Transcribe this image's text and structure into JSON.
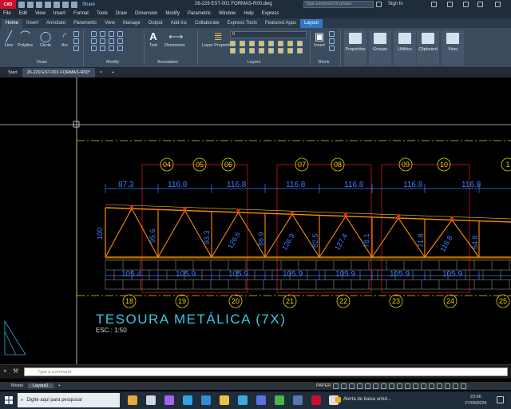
{
  "window": {
    "app_badge": "CAD",
    "share_label": "Share",
    "title": "26-229 EST-001 FORMAS-R00.dwg",
    "search_placeholder": "Type a keyword or phrase",
    "sign_in": "Sign In"
  },
  "menu": [
    "File",
    "Edit",
    "View",
    "Insert",
    "Format",
    "Tools",
    "Draw",
    "Dimension",
    "Modify",
    "Parametric",
    "Window",
    "Help",
    "Express"
  ],
  "ribbon_tabs": [
    "Home",
    "Insert",
    "Annotate",
    "Parametric",
    "View",
    "Manage",
    "Output",
    "Add-ins",
    "Collaborate",
    "Express Tools",
    "Featured Apps",
    "Layout"
  ],
  "ribbon": {
    "draw_tools": [
      "Line",
      "Polyline",
      "Circle",
      "Arc"
    ],
    "text_tool": "Text",
    "dimension_tool": "Dimension",
    "layer_properties": "Layer Properties",
    "layer_current": "0",
    "insert_tool": "Insert",
    "right_groups": [
      "Properties",
      "Groups",
      "Utilities",
      "Clipboard",
      "View"
    ],
    "panels": {
      "draw": "Draw",
      "modify": "Modify",
      "annotation": "Annotation",
      "layers": "Layers",
      "block": "Block"
    }
  },
  "file_tabs": {
    "start": "Start",
    "document": "26-229 EST-001 FORMAS-R00*"
  },
  "drawing": {
    "top_grid_labels": [
      "04",
      "05",
      "06",
      "07",
      "08",
      "09",
      "10",
      "1"
    ],
    "bottom_grid_labels": [
      "18",
      "19",
      "20",
      "21",
      "22",
      "23",
      "24",
      "25"
    ],
    "top_dimensions": [
      "87.3",
      "116.8",
      "116.8",
      "116.8",
      "116.8",
      "116.8",
      "116.8"
    ],
    "bottom_dimensions": [
      "105.4",
      "105.9",
      "105.9",
      "105.9",
      "105.9",
      "105.9",
      "105.9"
    ],
    "member_lengths": [
      "100",
      "95.6",
      "93.3",
      "126.6",
      "86.9",
      "126.9",
      "82.5",
      "78.1",
      "127.4",
      "71.8",
      "118.8",
      "64.8"
    ],
    "title": "TESOURA METÁLICA (7X)",
    "scale": "ESC.: 1:50"
  },
  "command_line": {
    "placeholder": "Type a command"
  },
  "layout_tabs": [
    "Model",
    "Layout1"
  ],
  "status": {
    "paper": "PAPER"
  },
  "taskbar": {
    "search": "Digite aqui para pesquisar",
    "notification": "Alerta de baixa umid...",
    "time": "23:06",
    "date": "27/09/2026"
  },
  "colors": {
    "accent": "#2f76c4",
    "dimension": "#3b7dff",
    "frame": "#e02020",
    "truss": "#ff8c00",
    "grid_circle": "#e6d200",
    "title_text": "#37c7e6"
  }
}
